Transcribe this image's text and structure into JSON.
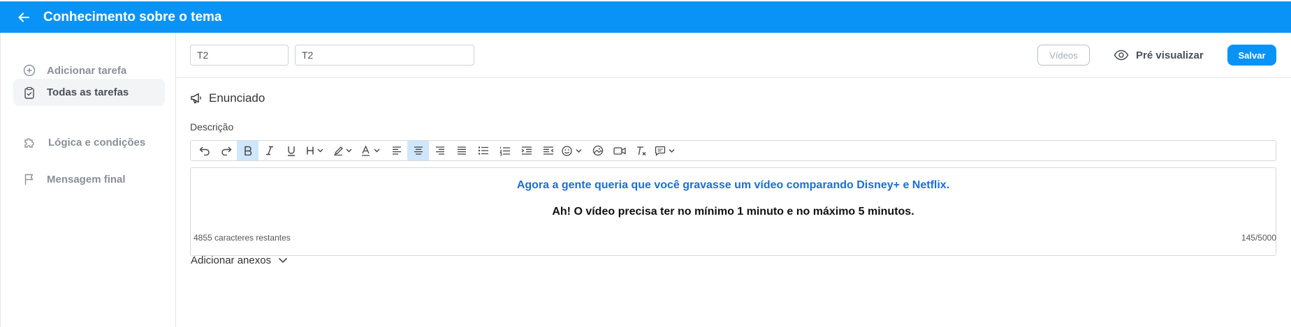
{
  "header": {
    "title": "Conhecimento sobre o tema"
  },
  "sidebar": {
    "items": [
      {
        "label": "Adicionar tarefa",
        "icon": "plus-circle-icon"
      },
      {
        "label": "Todas as tarefas",
        "icon": "clipboard-check-icon",
        "active": true
      },
      {
        "label": "Lógica e condições",
        "icon": "puzzle-icon"
      },
      {
        "label": "Mensagem final",
        "icon": "flag-icon"
      }
    ]
  },
  "toolbar": {
    "code_value": "T2",
    "name_value": "T2",
    "videos_label": "Vídeos",
    "preview_label": "Pré visualizar",
    "save_label": "Salvar"
  },
  "section": {
    "title": "Enunciado",
    "icon": "megaphone-icon"
  },
  "description": {
    "label": "Descrição",
    "content_line1": "Agora a gente queria que você gravasse um vídeo comparando Disney+ e Netflix.",
    "content_line2": "Ah! O vídeo precisa ter no mínimo 1 minuto e no máximo 5 minutos.",
    "chars_remaining": "4855 caracteres restantes",
    "chars_count": "145/5000"
  },
  "attachments": {
    "label": "Adicionar anexos"
  },
  "colors": {
    "brand": "#0a93f7",
    "link_text": "#1a6fd8",
    "active_tool": "#cfe6fb"
  }
}
